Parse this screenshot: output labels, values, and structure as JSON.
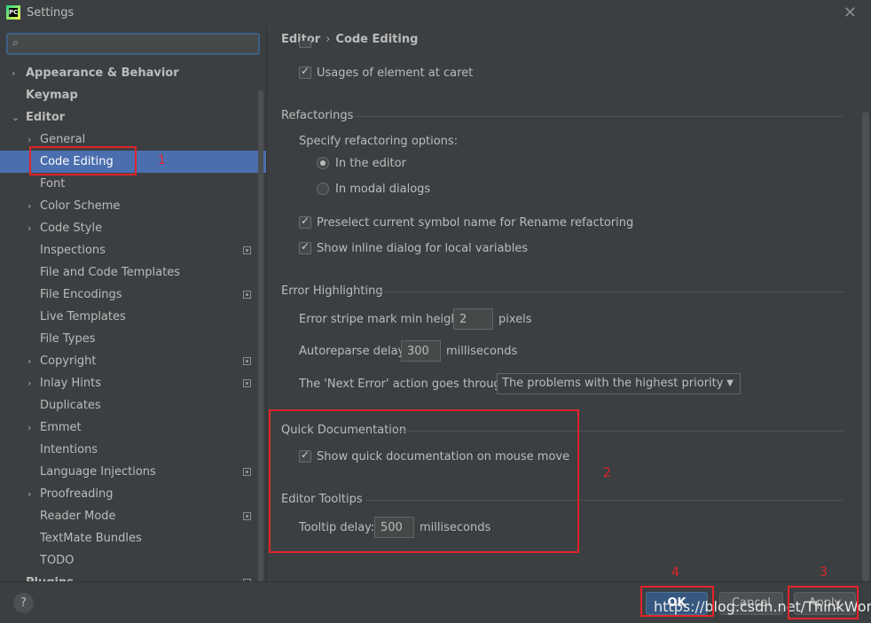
{
  "window": {
    "title": "Settings",
    "app_icon_text": "PC"
  },
  "search": {
    "placeholder": "",
    "value": ""
  },
  "sidebar": {
    "items": [
      {
        "label": "Appearance & Behavior",
        "bold": true,
        "arrow": "›"
      },
      {
        "label": "Keymap",
        "bold": true
      },
      {
        "label": "Editor",
        "bold": true,
        "arrow": "⌄"
      },
      {
        "label": "General",
        "arrow": "›"
      },
      {
        "label": "Code Editing",
        "selected": true
      },
      {
        "label": "Font"
      },
      {
        "label": "Color Scheme",
        "arrow": "›"
      },
      {
        "label": "Code Style",
        "arrow": "›"
      },
      {
        "label": "Inspections",
        "project_icon": true
      },
      {
        "label": "File and Code Templates"
      },
      {
        "label": "File Encodings",
        "project_icon": true
      },
      {
        "label": "Live Templates"
      },
      {
        "label": "File Types"
      },
      {
        "label": "Copyright",
        "arrow": "›",
        "project_icon": true
      },
      {
        "label": "Inlay Hints",
        "arrow": "›",
        "project_icon": true
      },
      {
        "label": "Duplicates"
      },
      {
        "label": "Emmet",
        "arrow": "›"
      },
      {
        "label": "Intentions"
      },
      {
        "label": "Language Injections",
        "project_icon": true
      },
      {
        "label": "Proofreading",
        "arrow": "›"
      },
      {
        "label": "Reader Mode",
        "project_icon": true
      },
      {
        "label": "TextMate Bundles"
      },
      {
        "label": "TODO"
      },
      {
        "label": "Plugins",
        "bold": true,
        "project_icon": true
      }
    ]
  },
  "breadcrumb": {
    "parent": "Editor",
    "separator": "›",
    "current": "Code Editing"
  },
  "content": {
    "usages_caret": {
      "label": "Usages of element at caret",
      "checked": true
    },
    "refactorings": {
      "title": "Refactorings",
      "specify": "Specify refactoring options:",
      "in_editor": "In the editor",
      "in_modal": "In modal dialogs",
      "preselect": "Preselect current symbol name for Rename refactoring",
      "inline_dialog": "Show inline dialog for local variables"
    },
    "error_highlighting": {
      "title": "Error Highlighting",
      "stripe_label": "Error stripe mark min height:",
      "stripe_value": "2",
      "stripe_unit": "pixels",
      "autoreparse_label": "Autoreparse delay:",
      "autoreparse_value": "300",
      "autoreparse_unit": "milliseconds",
      "next_error_label": "The 'Next Error' action goes through:",
      "next_error_value": "The problems with the highest priority"
    },
    "quick_doc": {
      "title": "Quick Documentation",
      "show_label": "Show quick documentation on mouse move"
    },
    "editor_tooltips": {
      "title": "Editor Tooltips",
      "delay_label": "Tooltip delay:",
      "delay_value": "500",
      "delay_unit": "milliseconds"
    }
  },
  "annotations": {
    "n1": "1",
    "n2": "2",
    "n3": "3",
    "n4": "4"
  },
  "footer": {
    "help": "?",
    "ok": "OK",
    "cancel": "Cancel",
    "apply": "Apply",
    "watermark": "https://blog.csdn.net/ThinkWon"
  },
  "colors": {
    "background": "#3c3f41",
    "selection": "#4b6eaf",
    "annotation_red": "#e2242a",
    "primary_button": "#365880"
  }
}
